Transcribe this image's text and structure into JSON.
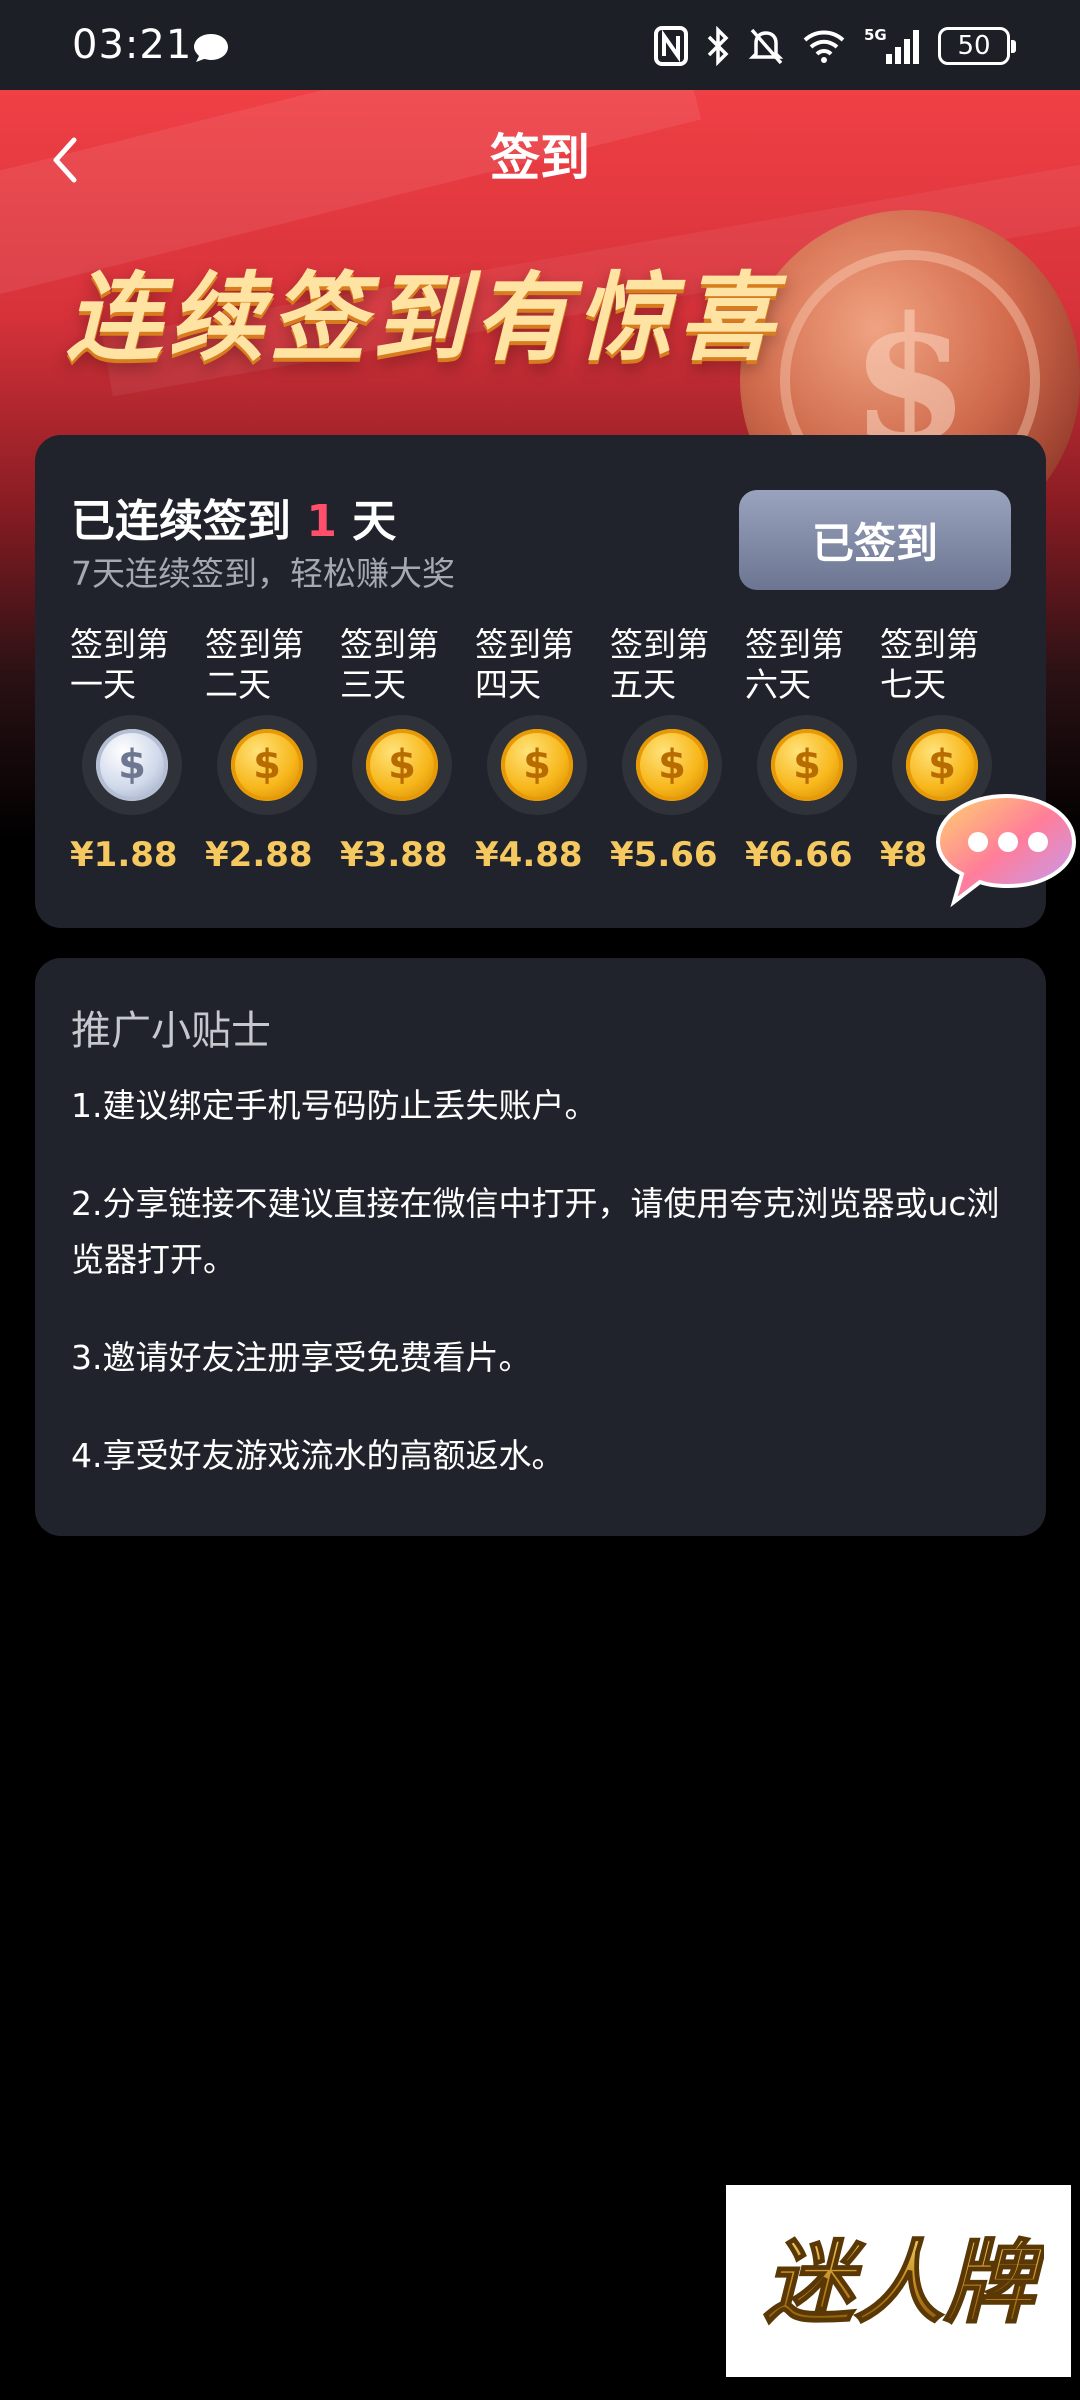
{
  "status_bar": {
    "time": "03:21",
    "icons": [
      "chat-icon",
      "nfc-icon",
      "bluetooth-icon",
      "mute-icon",
      "wifi-icon",
      "5g-signal-icon"
    ],
    "network": "5G",
    "battery": "50"
  },
  "header": {
    "title": "签到",
    "back_icon": "chevron-left-icon"
  },
  "banner": {
    "slogan": "连续签到有惊喜",
    "coin_symbol": "$"
  },
  "checkin": {
    "streak_prefix": "已连续签到 ",
    "streak_days": "1",
    "streak_suffix": " 天",
    "subtitle": "7天连续签到，轻松赚大奖",
    "button_label": "已签到",
    "days": [
      {
        "label": "签到第一天",
        "amount": "¥1.88",
        "claimed": true
      },
      {
        "label": "签到第二天",
        "amount": "¥2.88",
        "claimed": false
      },
      {
        "label": "签到第三天",
        "amount": "¥3.88",
        "claimed": false
      },
      {
        "label": "签到第四天",
        "amount": "¥4.88",
        "claimed": false
      },
      {
        "label": "签到第五天",
        "amount": "¥5.66",
        "claimed": false
      },
      {
        "label": "签到第六天",
        "amount": "¥6.66",
        "claimed": false
      },
      {
        "label": "签到第七天",
        "amount": "¥8",
        "claimed": false
      }
    ],
    "coin_symbol": "$"
  },
  "tips": {
    "title": "推广小贴士",
    "items": [
      "1.建议绑定手机号码防止丢失账户。",
      "2.分享链接不建议直接在微信中打开，请使用夸克浏览器或uc浏览器打开。",
      "3.邀请好友注册享受免费看片。",
      "4.享受好友游戏流水的高额返水。"
    ]
  },
  "watermark": {
    "text": "迷人牌"
  },
  "colors": {
    "page_bg": "#000000",
    "card_bg": "#20232b",
    "accent_red": "#ff4f6a",
    "gold": "#f5c860",
    "button_grey": "#8790ab"
  }
}
